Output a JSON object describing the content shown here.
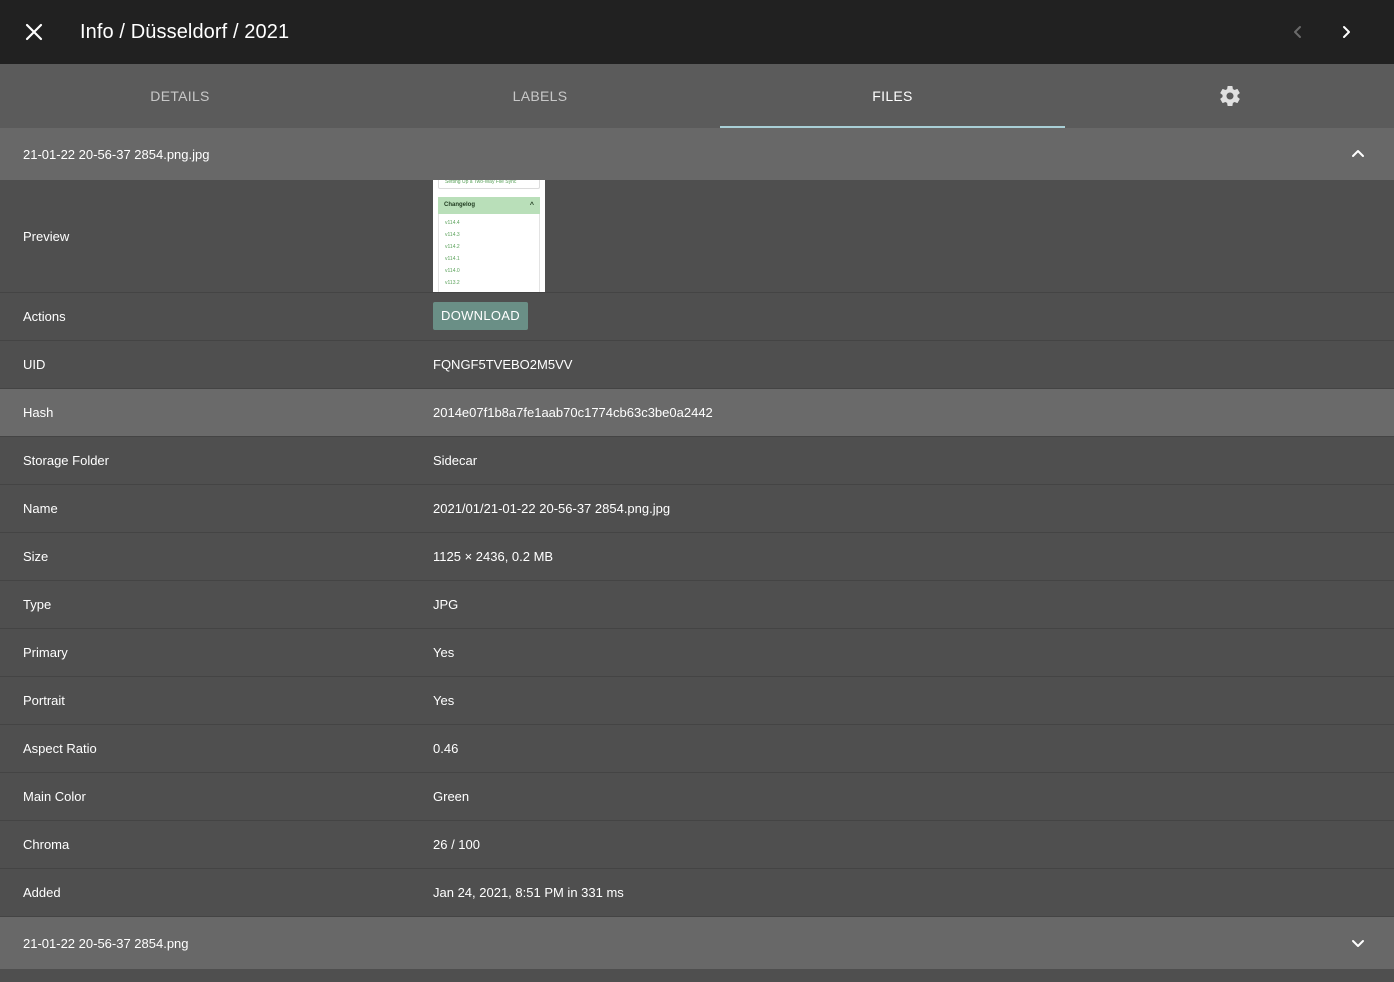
{
  "toolbar": {
    "title": "Info / Düsseldorf / 2021",
    "close_icon": "close-icon",
    "prev_icon": "chevron-left-icon",
    "next_icon": "chevron-right-icon"
  },
  "tabs": [
    {
      "label": "DETAILS",
      "active": false
    },
    {
      "label": "LABELS",
      "active": false
    },
    {
      "label": "FILES",
      "active": true
    },
    {
      "label": "",
      "icon": "gear-icon",
      "active": false
    }
  ],
  "colors": {
    "toolbar_bg": "#212121",
    "tabs_bg": "#5b5b5b",
    "tab_indicator": "#a9cfd6",
    "content_bg": "#4f4f4f",
    "header_bg": "#686868",
    "button_bg": "#6a8f86"
  },
  "files": [
    {
      "name": "21-01-22 20-56-37 2854.png.jpg",
      "expanded": true,
      "chevron_icon": "chevron-up-icon"
    },
    {
      "name": "21-01-22 20-56-37 2854.png",
      "expanded": false,
      "chevron_icon": "chevron-down-icon"
    }
  ],
  "preview": {
    "label": "Preview",
    "thumb_top_text": "Setting Up a Two-Way File Sync",
    "thumb_bar_text": "Changelog",
    "thumb_items": [
      "v114.4",
      "v114.3",
      "v114.2",
      "v114.1",
      "v114.0",
      "v113.2"
    ]
  },
  "actions": {
    "label": "Actions",
    "download_label": "DOWNLOAD"
  },
  "details": [
    {
      "label": "UID",
      "value": "FQNGF5TVEBO2M5VV"
    },
    {
      "label": "Hash",
      "value": "2014e07f1b8a7fe1aab70c1774cb63c3be0a2442"
    },
    {
      "label": "Storage Folder",
      "value": "Sidecar"
    },
    {
      "label": "Name",
      "value": "2021/01/21-01-22 20-56-37 2854.png.jpg"
    },
    {
      "label": "Size",
      "value": "1125 × 2436, 0.2 MB"
    },
    {
      "label": "Type",
      "value": "JPG"
    },
    {
      "label": "Primary",
      "value": "Yes"
    },
    {
      "label": "Portrait",
      "value": "Yes"
    },
    {
      "label": "Aspect Ratio",
      "value": "0.46"
    },
    {
      "label": "Main Color",
      "value": "Green"
    },
    {
      "label": "Chroma",
      "value": "26 / 100"
    },
    {
      "label": "Added",
      "value": "Jan 24, 2021, 8:51 PM in 331 ms"
    }
  ]
}
